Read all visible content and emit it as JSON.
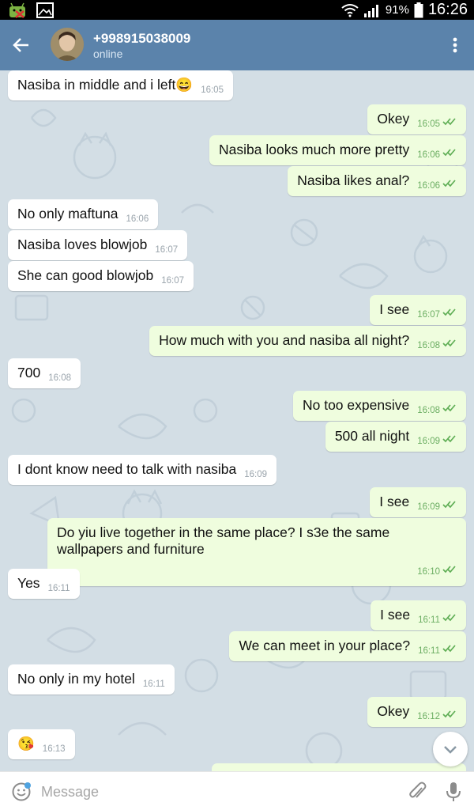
{
  "status_bar": {
    "battery": "91%",
    "time": "16:26",
    "icons": [
      "android-debug-icon",
      "gallery-icon",
      "wifi-icon",
      "signal-icon",
      "battery-icon"
    ]
  },
  "header": {
    "contact_name": "+998915038009",
    "status": "online",
    "bg_color": "#5b83ab"
  },
  "messages": [
    {
      "dir": "in",
      "text": "Nasiba in middle and i left😄",
      "time": "16:05"
    },
    {
      "dir": "out",
      "text": "Okey",
      "time": "16:05"
    },
    {
      "dir": "out",
      "text": "Nasiba looks much more pretty",
      "time": "16:06"
    },
    {
      "dir": "out",
      "text": "Nasiba likes anal?",
      "time": "16:06"
    },
    {
      "dir": "in",
      "text": "No only maftuna",
      "time": "16:06"
    },
    {
      "dir": "in",
      "text": "Nasiba loves blowjob",
      "time": "16:07"
    },
    {
      "dir": "in",
      "text": "She can good blowjob",
      "time": "16:07"
    },
    {
      "dir": "out",
      "text": "I see",
      "time": "16:07"
    },
    {
      "dir": "out",
      "text": "How much with you and nasiba all night?",
      "time": "16:08"
    },
    {
      "dir": "in",
      "text": "700",
      "time": "16:08"
    },
    {
      "dir": "out",
      "text": "No too expensive",
      "time": "16:08"
    },
    {
      "dir": "out",
      "text": "500 all night",
      "time": "16:09"
    },
    {
      "dir": "in",
      "text": "I dont know need to talk with nasiba",
      "time": "16:09"
    },
    {
      "dir": "out",
      "text": "I see",
      "time": "16:09"
    },
    {
      "dir": "out",
      "text": "Do yiu live together in the same place? I s3e the same wallpapers and furniture",
      "time": "16:10"
    },
    {
      "dir": "in",
      "text": "Yes",
      "time": "16:11"
    },
    {
      "dir": "out",
      "text": "I see",
      "time": "16:11"
    },
    {
      "dir": "out",
      "text": "We can meet in your place?",
      "time": "16:11"
    },
    {
      "dir": "in",
      "text": "No only in my hotel",
      "time": "16:11"
    },
    {
      "dir": "out",
      "text": "Okey",
      "time": "16:12"
    },
    {
      "dir": "in",
      "text": "😘",
      "time": "16:13"
    }
  ],
  "input": {
    "placeholder": "Message"
  },
  "colors": {
    "incoming_bg": "#ffffff",
    "outgoing_bg": "#effdde",
    "outgoing_time": "#6cae63",
    "chat_bg": "#d3dee5"
  }
}
